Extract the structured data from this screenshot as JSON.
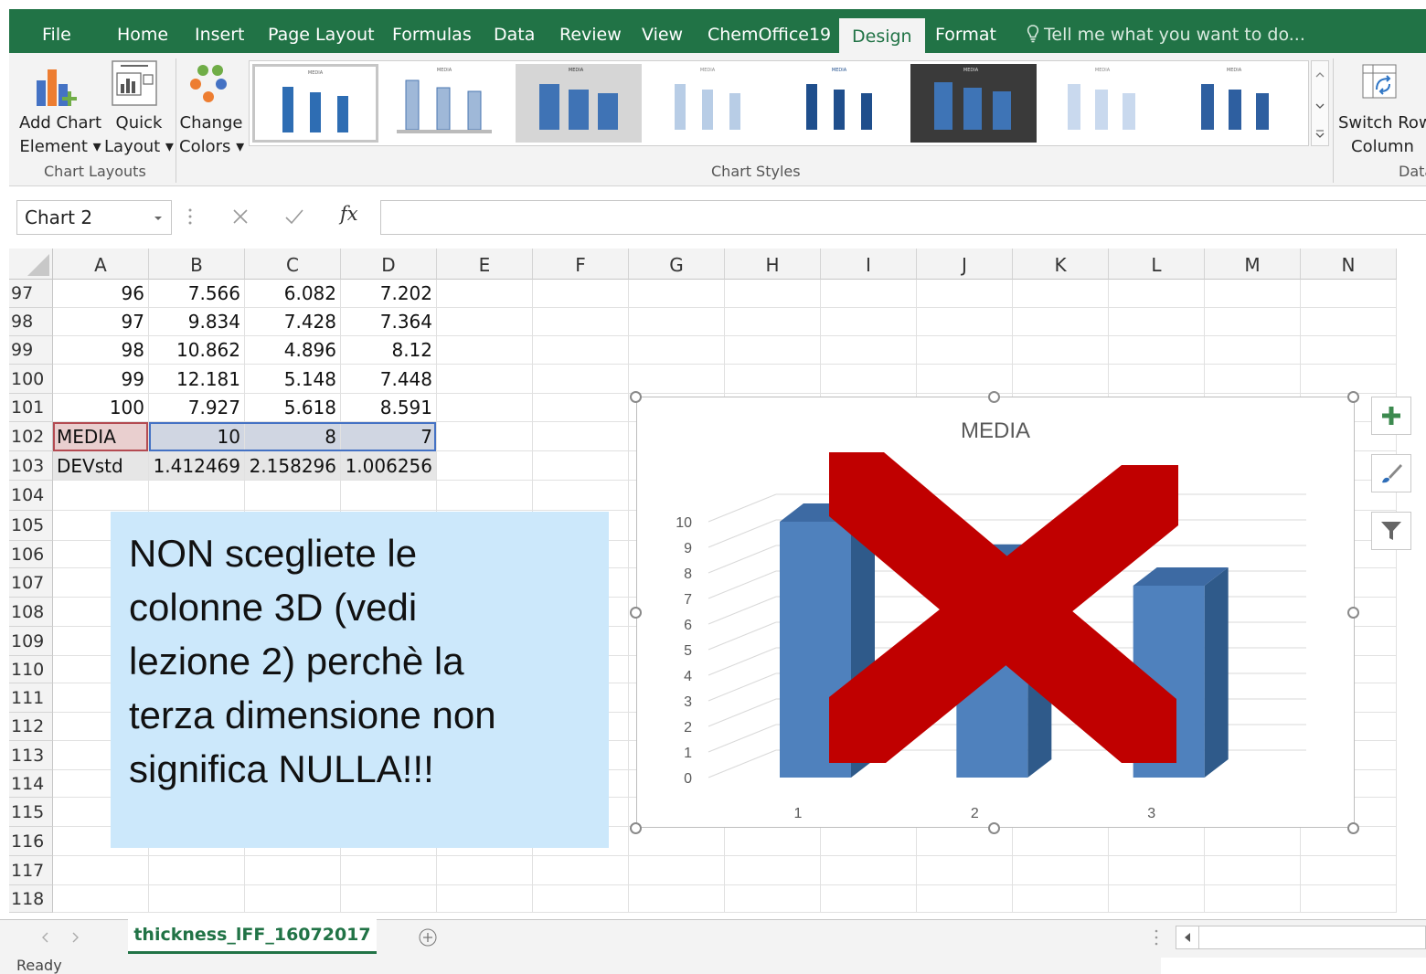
{
  "tabs": [
    "File",
    "Home",
    "Insert",
    "Page Layout",
    "Formulas",
    "Data",
    "Review",
    "View",
    "ChemOffice19",
    "Design",
    "Format"
  ],
  "active_tab": "Design",
  "tell_me": "Tell me what you want to do...",
  "ribbon": {
    "add_chart_element": [
      "Add Chart",
      "Element ▾"
    ],
    "quick_layout": [
      "Quick",
      "Layout ▾"
    ],
    "change_colors": [
      "Change",
      "Colors ▾"
    ],
    "switch_row_column": [
      "Switch Row/",
      "Column"
    ],
    "group_chart_layouts": "Chart Layouts",
    "group_chart_styles": "Chart Styles",
    "group_data": "Data",
    "style_thumb_title": "MEDIA"
  },
  "formula_bar": {
    "name_box": "Chart 2",
    "fx": "fx",
    "formula": ""
  },
  "columns": [
    "A",
    "B",
    "C",
    "D",
    "E",
    "F",
    "G",
    "H",
    "I",
    "J",
    "K",
    "L",
    "M",
    "N"
  ],
  "rows": [
    {
      "n": "97",
      "cells": [
        "96",
        "7.566",
        "6.082",
        "7.202"
      ]
    },
    {
      "n": "98",
      "cells": [
        "97",
        "9.834",
        "7.428",
        "7.364"
      ]
    },
    {
      "n": "99",
      "cells": [
        "98",
        "10.862",
        "4.896",
        "8.12"
      ]
    },
    {
      "n": "100",
      "cells": [
        "99",
        "12.181",
        "5.148",
        "7.448"
      ]
    },
    {
      "n": "101",
      "cells": [
        "100",
        "7.927",
        "5.618",
        "8.591"
      ]
    },
    {
      "n": "102",
      "cells": [
        "MEDIA",
        "10",
        "8",
        "7"
      ]
    },
    {
      "n": "103",
      "cells": [
        "DEVstd",
        "1.412469",
        "2.158296",
        "1.006256"
      ]
    },
    {
      "n": "104",
      "cells": []
    },
    {
      "n": "105",
      "cells": []
    },
    {
      "n": "106",
      "cells": []
    },
    {
      "n": "107",
      "cells": []
    },
    {
      "n": "108",
      "cells": []
    },
    {
      "n": "109",
      "cells": []
    },
    {
      "n": "110",
      "cells": []
    },
    {
      "n": "111",
      "cells": []
    },
    {
      "n": "112",
      "cells": []
    },
    {
      "n": "113",
      "cells": []
    },
    {
      "n": "114",
      "cells": []
    },
    {
      "n": "115",
      "cells": []
    },
    {
      "n": "116",
      "cells": []
    },
    {
      "n": "117",
      "cells": []
    },
    {
      "n": "118",
      "cells": []
    }
  ],
  "note_lines": [
    "NON scegliete le",
    "colonne 3D (vedi",
    "lezione 2) perchè la",
    "terza dimensione non",
    "significa NULLA!!!"
  ],
  "chart_data": {
    "type": "bar",
    "title": "MEDIA",
    "categories": [
      "1",
      "2",
      "3"
    ],
    "values": [
      10,
      8.4,
      7.5
    ],
    "ylim": [
      0,
      10
    ],
    "yticks": [
      0,
      1,
      2,
      3,
      4,
      5,
      6,
      7,
      8,
      9,
      10
    ],
    "grid": true,
    "style": "3d-column",
    "colors": {
      "bar": "#4f81bd",
      "bar_side": "#2f5a8a",
      "cross": "#c00000"
    }
  },
  "sheet_tab": "thickness_lFF_16072017",
  "status": "Ready",
  "colors": {
    "accent": "#217346",
    "note_bg": "#cce8fb"
  }
}
